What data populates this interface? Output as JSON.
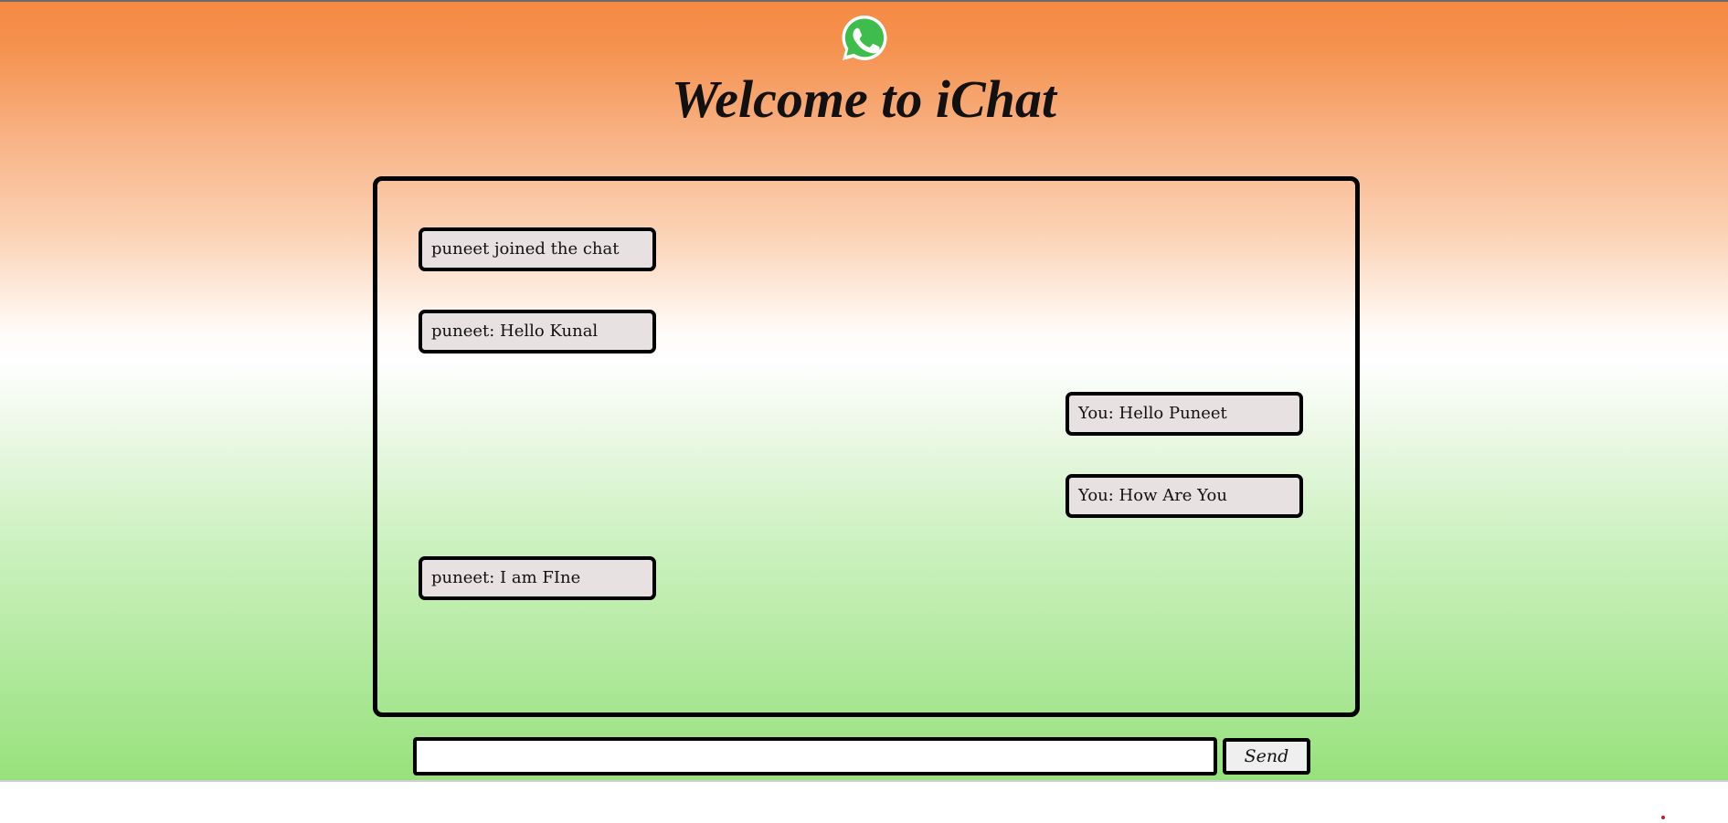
{
  "header": {
    "logo_icon": "whatsapp-icon",
    "title": "Welcome to iChat"
  },
  "messages": [
    {
      "text": "puneet joined the chat",
      "side": "left"
    },
    {
      "text": "puneet: Hello Kunal",
      "side": "left"
    },
    {
      "text": "You: Hello Puneet",
      "side": "right"
    },
    {
      "text": "You: How Are You",
      "side": "right"
    },
    {
      "text": "puneet: I am FIne",
      "side": "left"
    }
  ],
  "composer": {
    "input_value": "",
    "input_placeholder": "",
    "send_label": "Send"
  },
  "colors": {
    "gradient_top": "#f58a43",
    "gradient_middle": "#ffffff",
    "gradient_bottom": "#97e17c",
    "bubble_background": "#e8e1e2",
    "border": "#000000",
    "whatsapp_green": "#3fbd4c",
    "corner_dot": "#d01818"
  }
}
